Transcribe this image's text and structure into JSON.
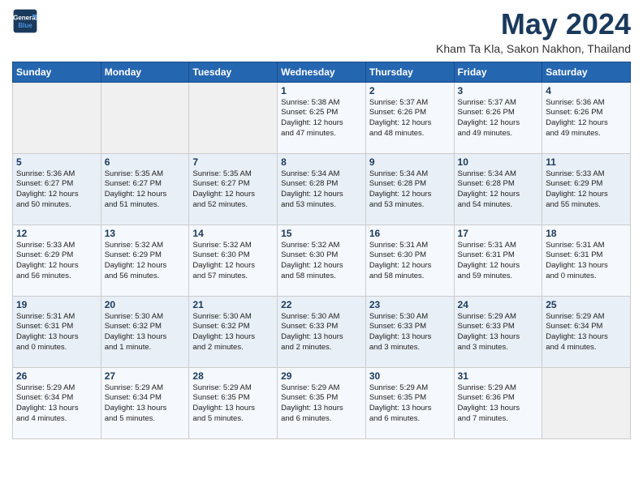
{
  "logo": {
    "line1": "General",
    "line2": "Blue"
  },
  "title": "May 2024",
  "location": "Kham Ta Kla, Sakon Nakhon, Thailand",
  "days_of_week": [
    "Sunday",
    "Monday",
    "Tuesday",
    "Wednesday",
    "Thursday",
    "Friday",
    "Saturday"
  ],
  "weeks": [
    [
      {
        "day": "",
        "info": ""
      },
      {
        "day": "",
        "info": ""
      },
      {
        "day": "",
        "info": ""
      },
      {
        "day": "1",
        "info": "Sunrise: 5:38 AM\nSunset: 6:25 PM\nDaylight: 12 hours\nand 47 minutes."
      },
      {
        "day": "2",
        "info": "Sunrise: 5:37 AM\nSunset: 6:26 PM\nDaylight: 12 hours\nand 48 minutes."
      },
      {
        "day": "3",
        "info": "Sunrise: 5:37 AM\nSunset: 6:26 PM\nDaylight: 12 hours\nand 49 minutes."
      },
      {
        "day": "4",
        "info": "Sunrise: 5:36 AM\nSunset: 6:26 PM\nDaylight: 12 hours\nand 49 minutes."
      }
    ],
    [
      {
        "day": "5",
        "info": "Sunrise: 5:36 AM\nSunset: 6:27 PM\nDaylight: 12 hours\nand 50 minutes."
      },
      {
        "day": "6",
        "info": "Sunrise: 5:35 AM\nSunset: 6:27 PM\nDaylight: 12 hours\nand 51 minutes."
      },
      {
        "day": "7",
        "info": "Sunrise: 5:35 AM\nSunset: 6:27 PM\nDaylight: 12 hours\nand 52 minutes."
      },
      {
        "day": "8",
        "info": "Sunrise: 5:34 AM\nSunset: 6:28 PM\nDaylight: 12 hours\nand 53 minutes."
      },
      {
        "day": "9",
        "info": "Sunrise: 5:34 AM\nSunset: 6:28 PM\nDaylight: 12 hours\nand 53 minutes."
      },
      {
        "day": "10",
        "info": "Sunrise: 5:34 AM\nSunset: 6:28 PM\nDaylight: 12 hours\nand 54 minutes."
      },
      {
        "day": "11",
        "info": "Sunrise: 5:33 AM\nSunset: 6:29 PM\nDaylight: 12 hours\nand 55 minutes."
      }
    ],
    [
      {
        "day": "12",
        "info": "Sunrise: 5:33 AM\nSunset: 6:29 PM\nDaylight: 12 hours\nand 56 minutes."
      },
      {
        "day": "13",
        "info": "Sunrise: 5:32 AM\nSunset: 6:29 PM\nDaylight: 12 hours\nand 56 minutes."
      },
      {
        "day": "14",
        "info": "Sunrise: 5:32 AM\nSunset: 6:30 PM\nDaylight: 12 hours\nand 57 minutes."
      },
      {
        "day": "15",
        "info": "Sunrise: 5:32 AM\nSunset: 6:30 PM\nDaylight: 12 hours\nand 58 minutes."
      },
      {
        "day": "16",
        "info": "Sunrise: 5:31 AM\nSunset: 6:30 PM\nDaylight: 12 hours\nand 58 minutes."
      },
      {
        "day": "17",
        "info": "Sunrise: 5:31 AM\nSunset: 6:31 PM\nDaylight: 12 hours\nand 59 minutes."
      },
      {
        "day": "18",
        "info": "Sunrise: 5:31 AM\nSunset: 6:31 PM\nDaylight: 13 hours\nand 0 minutes."
      }
    ],
    [
      {
        "day": "19",
        "info": "Sunrise: 5:31 AM\nSunset: 6:31 PM\nDaylight: 13 hours\nand 0 minutes."
      },
      {
        "day": "20",
        "info": "Sunrise: 5:30 AM\nSunset: 6:32 PM\nDaylight: 13 hours\nand 1 minute."
      },
      {
        "day": "21",
        "info": "Sunrise: 5:30 AM\nSunset: 6:32 PM\nDaylight: 13 hours\nand 2 minutes."
      },
      {
        "day": "22",
        "info": "Sunrise: 5:30 AM\nSunset: 6:33 PM\nDaylight: 13 hours\nand 2 minutes."
      },
      {
        "day": "23",
        "info": "Sunrise: 5:30 AM\nSunset: 6:33 PM\nDaylight: 13 hours\nand 3 minutes."
      },
      {
        "day": "24",
        "info": "Sunrise: 5:29 AM\nSunset: 6:33 PM\nDaylight: 13 hours\nand 3 minutes."
      },
      {
        "day": "25",
        "info": "Sunrise: 5:29 AM\nSunset: 6:34 PM\nDaylight: 13 hours\nand 4 minutes."
      }
    ],
    [
      {
        "day": "26",
        "info": "Sunrise: 5:29 AM\nSunset: 6:34 PM\nDaylight: 13 hours\nand 4 minutes."
      },
      {
        "day": "27",
        "info": "Sunrise: 5:29 AM\nSunset: 6:34 PM\nDaylight: 13 hours\nand 5 minutes."
      },
      {
        "day": "28",
        "info": "Sunrise: 5:29 AM\nSunset: 6:35 PM\nDaylight: 13 hours\nand 5 minutes."
      },
      {
        "day": "29",
        "info": "Sunrise: 5:29 AM\nSunset: 6:35 PM\nDaylight: 13 hours\nand 6 minutes."
      },
      {
        "day": "30",
        "info": "Sunrise: 5:29 AM\nSunset: 6:35 PM\nDaylight: 13 hours\nand 6 minutes."
      },
      {
        "day": "31",
        "info": "Sunrise: 5:29 AM\nSunset: 6:36 PM\nDaylight: 13 hours\nand 7 minutes."
      },
      {
        "day": "",
        "info": ""
      }
    ]
  ]
}
